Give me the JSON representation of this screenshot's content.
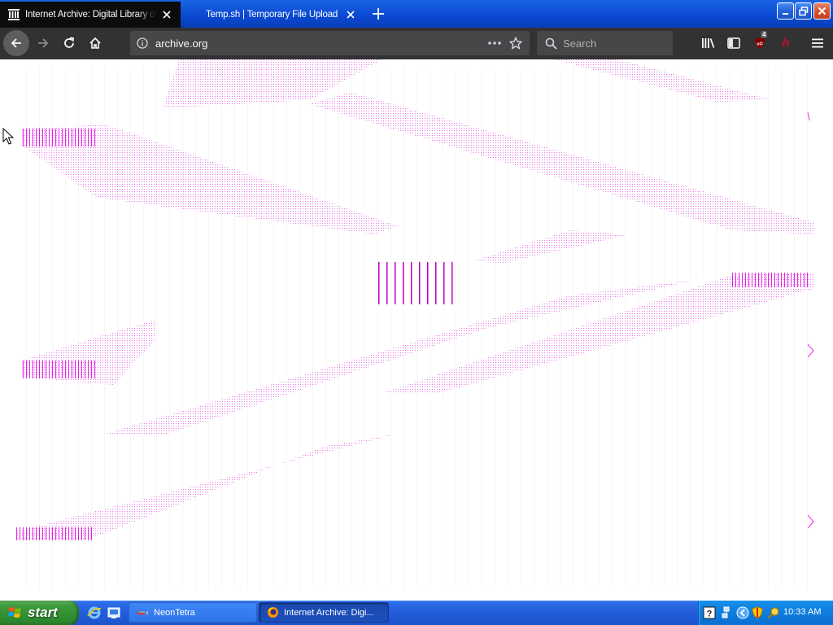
{
  "browser": {
    "tabs": [
      {
        "label": "Internet Archive: Digital Library of",
        "active": true,
        "favicon": "archive-building-icon"
      },
      {
        "label": "Temp.sh | Temporary File Upload",
        "active": false,
        "favicon": ""
      }
    ],
    "url": "archive.org",
    "search_placeholder": "Search",
    "ublock_badge": "4",
    "ext_h_label": "h",
    "colors": {
      "tabstrip": "#0a48d0",
      "active_tab": "#0c0c0d",
      "toolbar": "#323234",
      "field": "#474749",
      "glitch": "#e000e0"
    }
  },
  "page": {
    "rendering": "corrupted/glitched pattern"
  },
  "taskbar": {
    "start_label": "start",
    "items": [
      {
        "label": "NeonTetra",
        "icon": "neontetra-icon",
        "active": false
      },
      {
        "label": "Internet Archive: Digi...",
        "icon": "firefox-icon",
        "active": true
      }
    ],
    "clock": "10:33 AM"
  }
}
